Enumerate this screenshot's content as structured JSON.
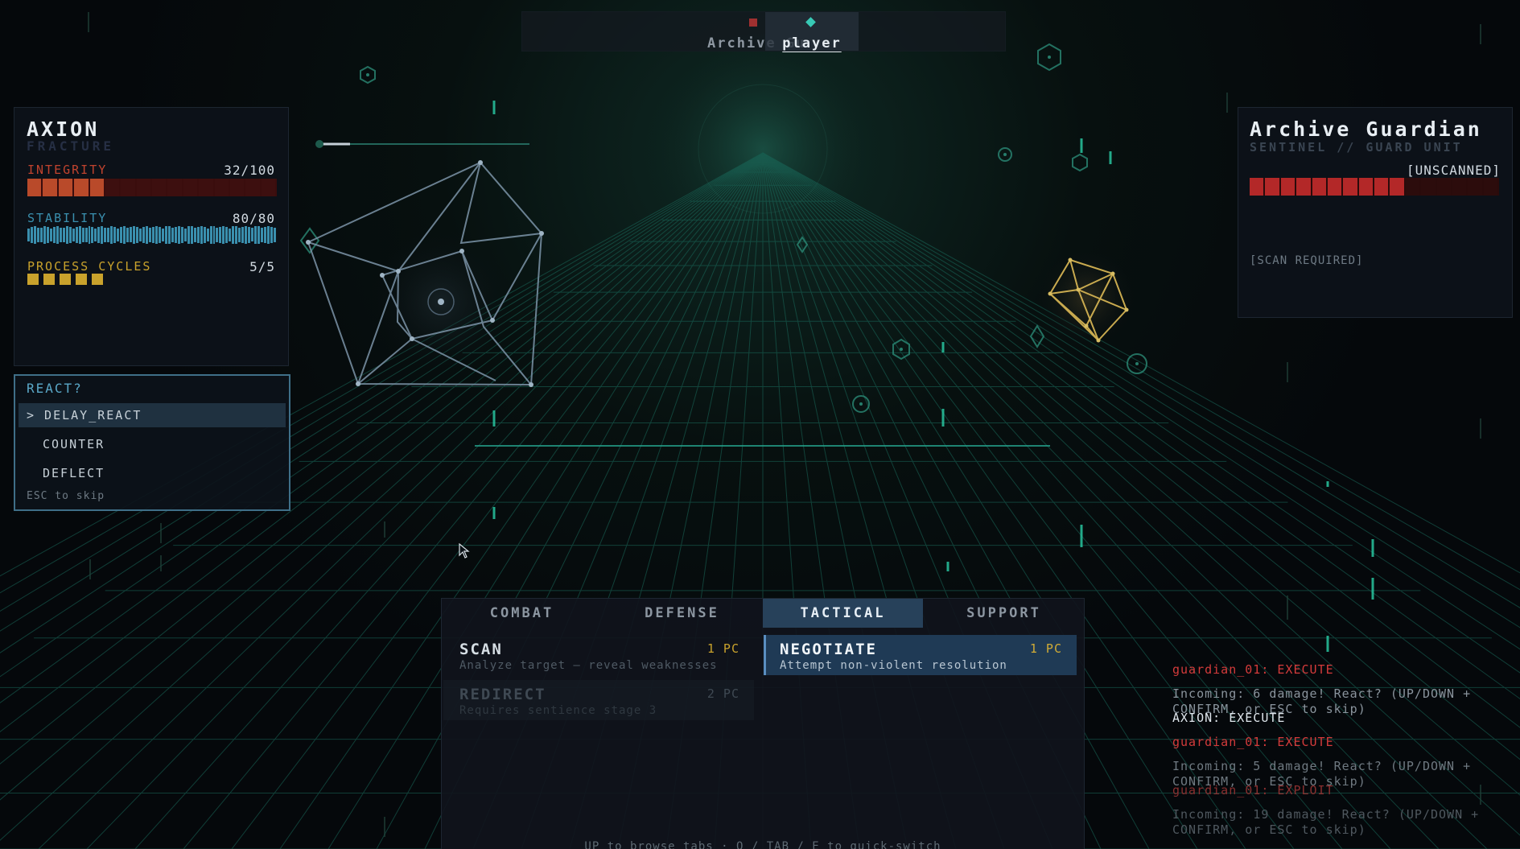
{
  "turn_order": [
    {
      "label": "Archive Gu",
      "kind": "enemy",
      "active": false
    },
    {
      "label": "player",
      "kind": "player",
      "active": true
    }
  ],
  "player": {
    "name": "AXION",
    "subtitle": "FRACTURE",
    "integrity": {
      "label": "INTEGRITY",
      "value_text": "32/100",
      "fraction": 0.32,
      "color": "#c0432e"
    },
    "stability": {
      "label": "STABILITY",
      "value_text": "80/80",
      "fraction": 1.0,
      "color": "#3a8fae"
    },
    "process_cycles": {
      "label": "PROCESS CYCLES",
      "value_text": "5/5",
      "count": 5,
      "max": 5,
      "color": "#c9a22c"
    }
  },
  "react_prompt": {
    "title": "REACT?",
    "options": [
      {
        "label": "> DELAY_REACT",
        "selected": true
      },
      {
        "label": "COUNTER",
        "selected": false
      },
      {
        "label": "DEFLECT",
        "selected": false
      }
    ],
    "hint": "ESC to skip"
  },
  "enemy": {
    "name": "Archive Guardian",
    "subtitle": "SENTINEL // GUARD UNIT",
    "scan_status": "[UNSCANNED]",
    "health_fraction": 0.62,
    "health_color": "#b32828",
    "scan_note": "[SCAN REQUIRED]"
  },
  "action_menu": {
    "tabs": [
      {
        "label": "COMBAT",
        "active": false
      },
      {
        "label": "DEFENSE",
        "active": false
      },
      {
        "label": "TACTICAL",
        "active": true
      },
      {
        "label": "SUPPORT",
        "active": false
      }
    ],
    "actions": [
      {
        "name": "SCAN",
        "cost": "1 PC",
        "desc": "Analyze target — reveal weaknesses",
        "state": "normal"
      },
      {
        "name": "NEGOTIATE",
        "cost": "1 PC",
        "desc": "Attempt non-violent resolution",
        "state": "selected"
      },
      {
        "name": "REDIRECT",
        "cost": "2 PC",
        "desc": "Requires sentience stage 3",
        "state": "disabled"
      }
    ],
    "footer_hint": "UP to browse tabs  ·  Q / TAB / E to quick-switch"
  },
  "combat_log": [
    {
      "text": "guardian_01: EXECUTE",
      "kind": "enemy"
    },
    {
      "text": "Incoming: 6 damage! React? (UP/DOWN + CONFIRM, or ESC to skip)",
      "kind": "info"
    },
    {
      "text": "AXION: EXECUTE",
      "kind": "player"
    },
    {
      "text": "guardian_01: EXECUTE",
      "kind": "enemy"
    },
    {
      "text": "Incoming: 5 damage! React? (UP/DOWN + CONFIRM, or ESC to skip)",
      "kind": "info"
    },
    {
      "text": "guardian_01: EXPLOIT",
      "kind": "enemy"
    },
    {
      "text": "Incoming: 19 damage! React? (UP/DOWN + CONFIRM, or ESC to skip)",
      "kind": "info"
    }
  ],
  "colors": {
    "accent": "#38c9b5",
    "enemy_text": "#d43b3b",
    "player_text": "#dfe6ec",
    "info_text": "#8a949d",
    "gold": "#c9a22c"
  },
  "icons": {
    "player_avatar": "wireframe-polyhedron-icon",
    "enemy_avatar": "gold-polyhedron-icon",
    "cursor": "mouse-pointer-icon"
  }
}
